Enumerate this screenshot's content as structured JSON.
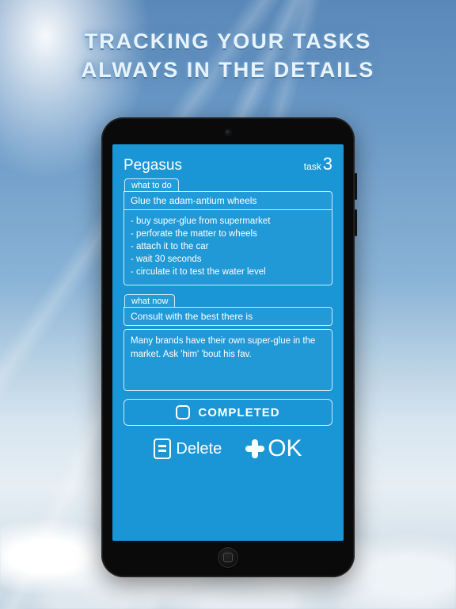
{
  "promo": {
    "line1": "TRACKING YOUR TASKS",
    "line2": "ALWAYS IN THE DETAILS"
  },
  "screen": {
    "title": "Pegasus",
    "task_label": "task",
    "task_number": "3",
    "section1": {
      "tab": "what to do",
      "summary": "Glue the adam-antium wheels",
      "details": "- buy super-glue from supermarket\n- perforate the matter to wheels\n- attach it to the car\n- wait 30 seconds\n- circulate it to test the water level"
    },
    "section2": {
      "tab": "what now",
      "summary": "Consult with the best there is",
      "details": "Many brands have their own super-glue in the market. Ask 'him' 'bout his fav."
    },
    "completed_label": "COMPLETED",
    "delete_label": "Delete",
    "ok_label": "OK"
  }
}
